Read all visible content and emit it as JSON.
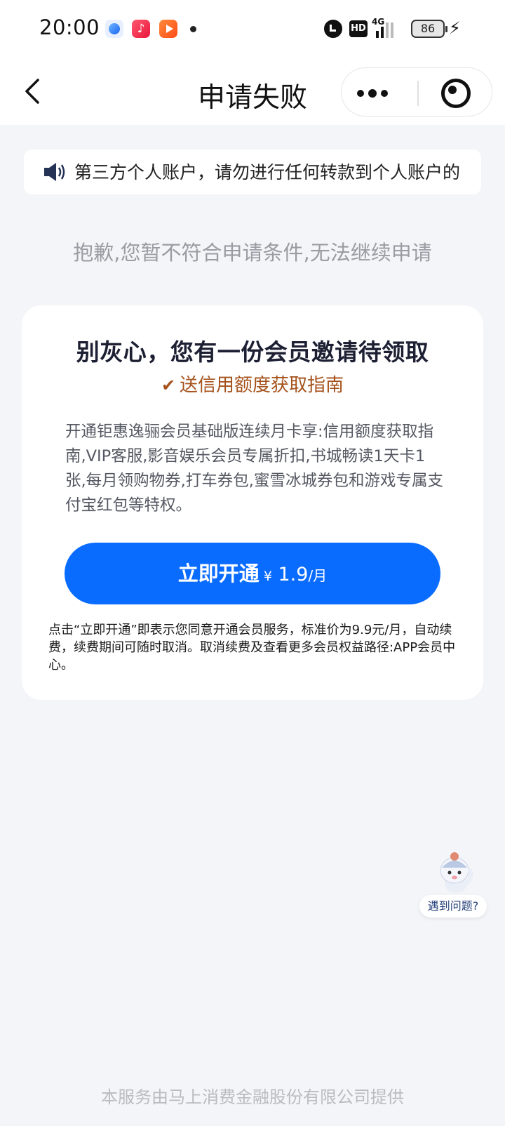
{
  "status_bar": {
    "time": "20:00",
    "network": "4G",
    "hd_label": "HD",
    "battery_level": "86"
  },
  "nav": {
    "title": "申请失败"
  },
  "notice": {
    "text": "第三方个人账户，请勿进行任何转款到个人账户的"
  },
  "fail_message": "抱歉,您暂不符合申请条件,无法继续申请",
  "card": {
    "title": "别灰心，您有一份会员邀请待领取",
    "gift": "送信用额度获取指南",
    "description": "开通钜惠逸骊会员基础版连续月卡享:信用额度获取指南,VIP客服,影音娱乐会员专属折扣,书城畅读1天卡1张,每月领购物券,打车券包,蜜雪冰城券包和游戏专属支付宝红包等特权。",
    "cta": {
      "label": "立即开通",
      "currency": "¥",
      "price": " 1.9",
      "unit": "/月"
    },
    "agreement": "点击“立即开通”即表示您同意开通会员服务，标准价为9.9元/月，自动续费，续费期间可随时取消。取消续费及查看更多会员权益路径:APP会员中心。"
  },
  "help": {
    "label": "遇到问题?"
  },
  "footer": "本服务由马上消费金融股份有限公司提供",
  "colors": {
    "primary": "#0a6cff",
    "gift": "#a5521c",
    "background": "#f4f5f8"
  }
}
